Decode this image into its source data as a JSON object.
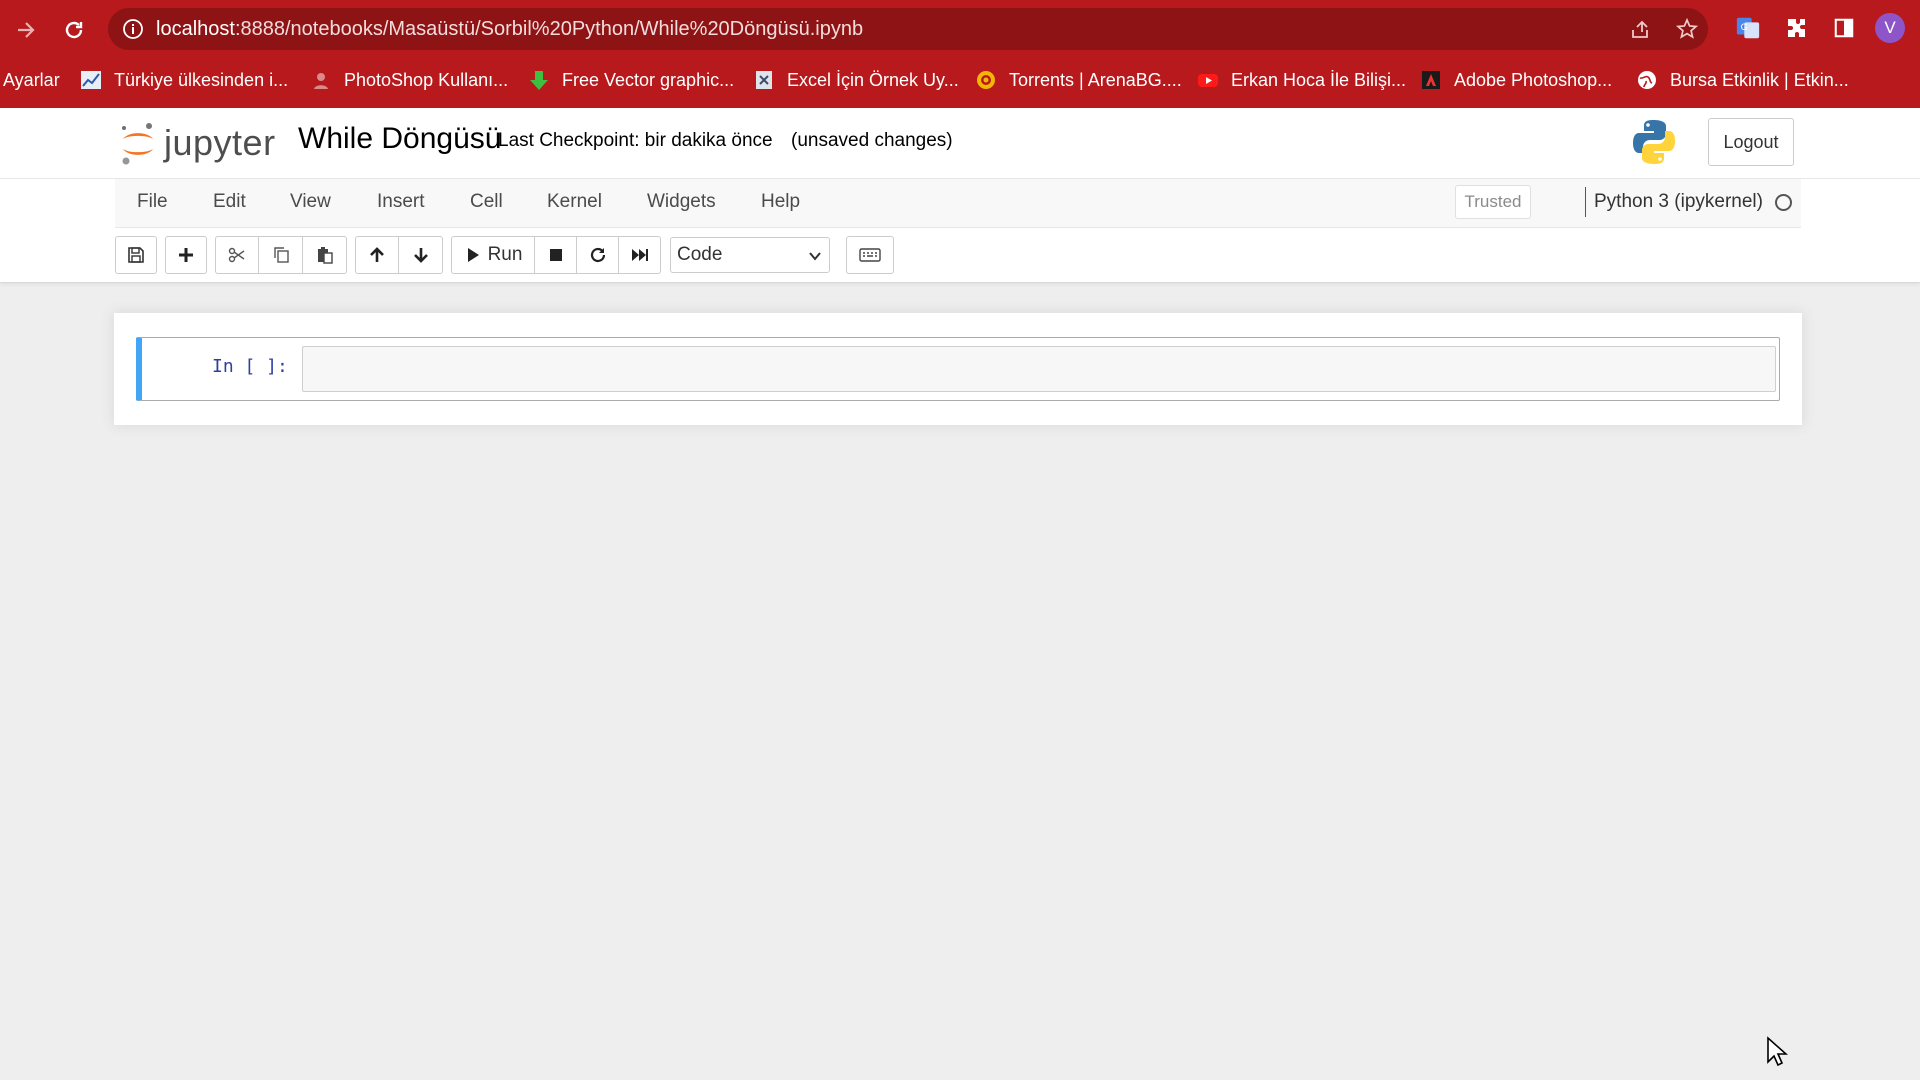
{
  "browser": {
    "url": {
      "host": "localhost",
      "rest": ":8888/notebooks/Masaüstü/Sorbil%20Python/While%20Döngüsü.ipynb"
    },
    "avatar_letter": "V",
    "bookmarks": [
      {
        "label": "Ayarlar",
        "icon": "settings-truncated"
      },
      {
        "label": "Türkiye ülkesinden i...",
        "icon": "chart-icon"
      },
      {
        "label": "PhotoShop Kullanı...",
        "icon": "photoshop-site-icon"
      },
      {
        "label": "Free Vector graphic...",
        "icon": "download-arrow-icon"
      },
      {
        "label": "Excel İçin Örnek Uy...",
        "icon": "excel-site-icon"
      },
      {
        "label": "Torrents | ArenaBG....",
        "icon": "arenabg-icon"
      },
      {
        "label": "Erkan Hoca İle Bilişi...",
        "icon": "youtube-icon"
      },
      {
        "label": "Adobe Photoshop...",
        "icon": "adobe-icon"
      },
      {
        "label": "Bursa Etkinlik | Etkin...",
        "icon": "globe-icon"
      }
    ]
  },
  "header": {
    "logo_text": "jupyter",
    "notebook_name": "While Döngüsü",
    "checkpoint": "Last Checkpoint: bir dakika önce",
    "autosave": "(unsaved changes)",
    "logout": "Logout"
  },
  "menubar": {
    "items": [
      "File",
      "Edit",
      "View",
      "Insert",
      "Cell",
      "Kernel",
      "Widgets",
      "Help"
    ],
    "trusted": "Trusted",
    "kernel": "Python 3 (ipykernel)"
  },
  "toolbar": {
    "run_label": "Run",
    "cell_type": "Code"
  },
  "cell": {
    "prompt": "In [ ]:",
    "source": ""
  },
  "colors": {
    "browser_chrome": "#b8191c",
    "cell_selected_border": "#42a5f5",
    "prompt_color": "#303f9f",
    "jupyter_orange": "#f37626"
  }
}
